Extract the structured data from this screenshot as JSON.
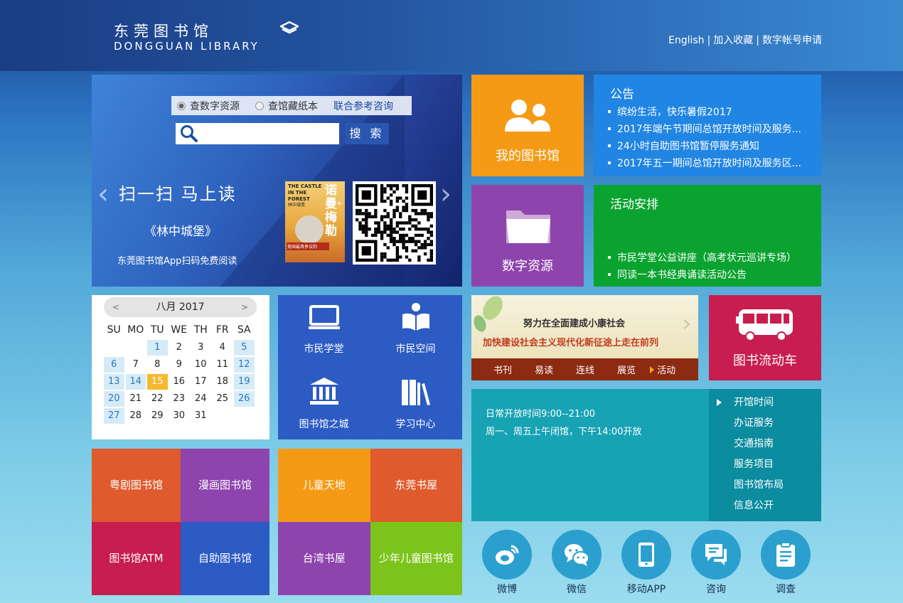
{
  "header": {
    "logo_cn": "东莞图书馆",
    "logo_en": "DONGGUAN LIBRARY",
    "links": [
      "English",
      "加入收藏",
      "数字帐号申请"
    ],
    "separator": "|"
  },
  "banner": {
    "search_options": [
      "查数字资源",
      "查馆藏纸本"
    ],
    "reference_link": "联合参考咨询",
    "search_placeholder": "",
    "search_button": "搜 索",
    "prev_arrow": "‹",
    "next_arrow": "›",
    "title": "扫一扫  马上读",
    "book_name": "《林中城堡》",
    "caption": "东莞图书馆App扫码免费阅读",
    "cover_en": "THE CASTLE IN THE FOREST",
    "cover_cn_small": "林中城堡",
    "cover_author": "诺曼·梅勒",
    "cover_tag": "美国最具争议的"
  },
  "tiles": {
    "my_library": "我的图书馆",
    "digital_resources": "数字资源",
    "bookmobile": "图书流动车"
  },
  "notices": {
    "title": "公告",
    "items": [
      "缤纷生活，快乐暑假2017",
      "2017年端午节期间总馆开放时间及服务...",
      "24小时自助图书馆暂停服务通知",
      "2017年五一期间总馆开放时间及服务区..."
    ]
  },
  "activities": {
    "title": "活动安排",
    "items": [
      "市民学堂公益讲座（高考状元巡讲专场）",
      "同读一本书经典诵读活动公告"
    ]
  },
  "calendar": {
    "month_label": "八月 2017",
    "prev": "<",
    "next": ">",
    "weekdays": [
      "SU",
      "MO",
      "TU",
      "WE",
      "TH",
      "FR",
      "SA"
    ],
    "offset": 2,
    "days": 31,
    "today": 15,
    "highlighted": [
      1,
      5,
      6,
      12,
      13,
      14,
      19,
      20,
      26,
      27
    ]
  },
  "services": [
    "市民学堂",
    "市民空间",
    "图书馆之城",
    "学习中心"
  ],
  "slide": {
    "line1": "努力在全面建成小康社会",
    "line2": "加快建设社会主义现代化新征途上走在前列",
    "tabs": [
      "书刊",
      "易读",
      "连线",
      "展览",
      "活动"
    ],
    "active_tab": "活动"
  },
  "hours": {
    "line1": "日常开放时间9:00--21:00",
    "line2": "周一、周五上午闭馆，下午14:00开放",
    "menu": [
      "开馆时间",
      "办证服务",
      "交通指南",
      "服务项目",
      "图书馆布局",
      "信息公开"
    ]
  },
  "libraries": [
    "粤剧图书馆",
    "漫画图书馆",
    "图书馆ATM",
    "自助图书馆"
  ],
  "kids": [
    "儿童天地",
    "东莞书屋",
    "台湾书屋",
    "少年儿童图书馆"
  ],
  "social": [
    "微博",
    "微信",
    "移动APP",
    "咨询",
    "调查"
  ],
  "colors": {
    "orange": "#f59a15",
    "purple": "#8e44ad",
    "blue": "#2185e3",
    "green": "#0aa32f",
    "crimson": "#c81d4f",
    "teal": "#17a3b4",
    "red_orange": "#df5a2c",
    "lime": "#7cc41b"
  }
}
